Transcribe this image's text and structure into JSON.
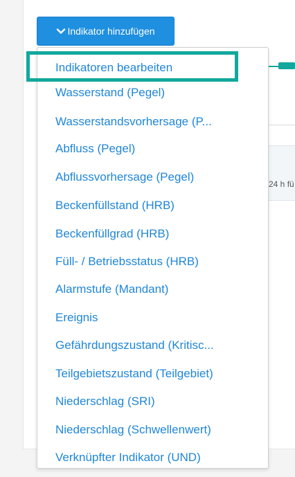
{
  "toolbar": {
    "add_indicator_label": "Indikator hinzufügen",
    "add_indicator_icon": "chevron-down-icon"
  },
  "background": {
    "card_text": "24 h fü"
  },
  "dropdown": {
    "items": [
      {
        "label": "Indikatoren bearbeiten"
      },
      {
        "label": "Wasserstand (Pegel)"
      },
      {
        "label": "Wasserstandsvorhersage (P..."
      },
      {
        "label": "Abfluss (Pegel)"
      },
      {
        "label": "Abflussvorhersage (Pegel)"
      },
      {
        "label": "Beckenfüllstand (HRB)"
      },
      {
        "label": "Beckenfüllgrad (HRB)"
      },
      {
        "label": "Füll- / Betriebsstatus (HRB)"
      },
      {
        "label": "Alarmstufe (Mandant)"
      },
      {
        "label": "Ereignis"
      },
      {
        "label": "Gefährdungszustand (Kritisc..."
      },
      {
        "label": "Teilgebietszustand (Teilgebiet)"
      },
      {
        "label": "Niederschlag (SRI)"
      },
      {
        "label": "Niederschlag (Schwellenwert)"
      },
      {
        "label": "Verknüpfter Indikator (UND)"
      }
    ]
  },
  "colors": {
    "accent_blue": "#1f8fe0",
    "link_blue": "#1f86d8",
    "highlight_teal": "#12a89d"
  }
}
